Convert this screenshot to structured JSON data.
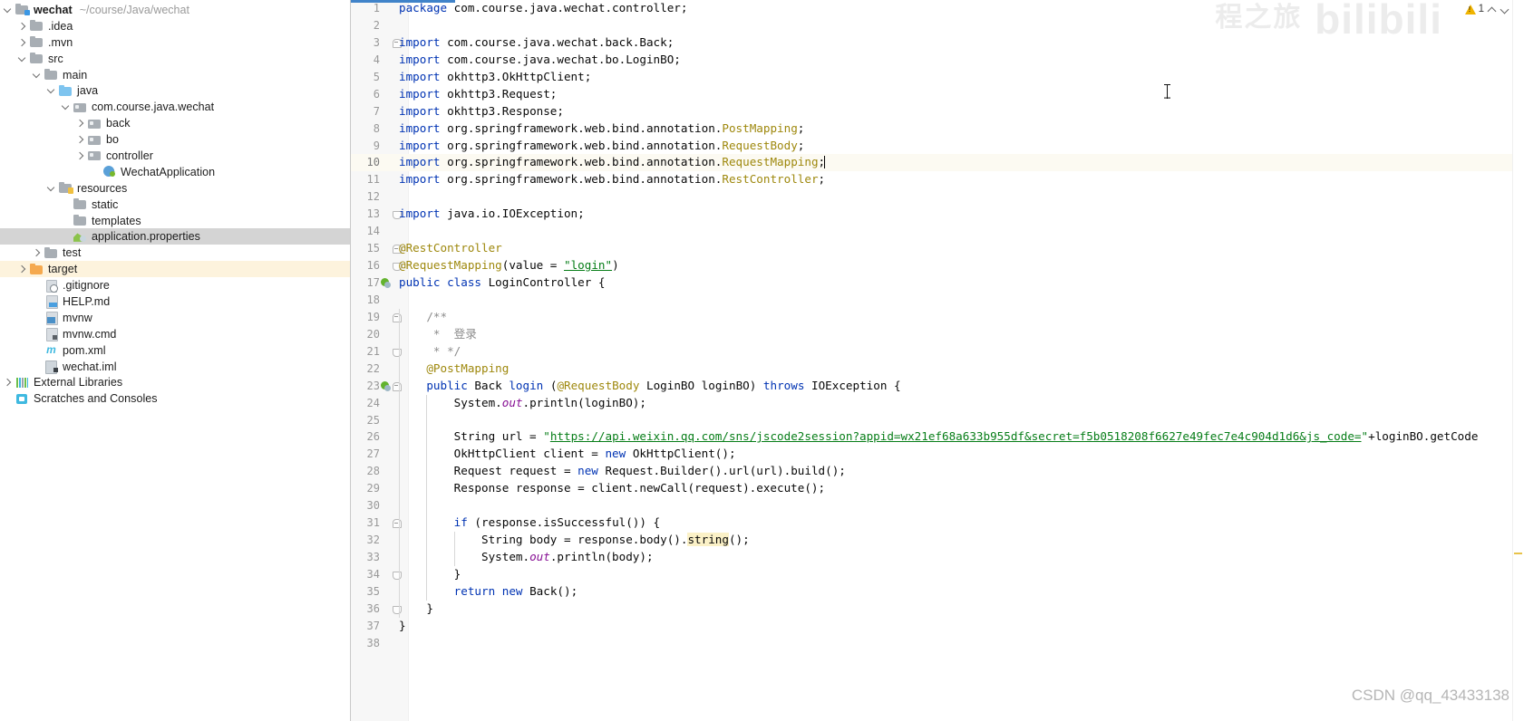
{
  "project": {
    "root": {
      "name": "wechat",
      "path": "~/course/Java/wechat"
    },
    "items": [
      {
        "label": ".idea",
        "indent": 1,
        "twisty": "closed",
        "icon": "folder",
        "state": ""
      },
      {
        "label": ".mvn",
        "indent": 1,
        "twisty": "closed",
        "icon": "folder",
        "state": ""
      },
      {
        "label": "src",
        "indent": 1,
        "twisty": "open",
        "icon": "folder",
        "state": ""
      },
      {
        "label": "main",
        "indent": 2,
        "twisty": "open",
        "icon": "folder",
        "state": ""
      },
      {
        "label": "java",
        "indent": 3,
        "twisty": "open",
        "icon": "folder-src",
        "state": ""
      },
      {
        "label": "com.course.java.wechat",
        "indent": 4,
        "twisty": "open",
        "icon": "folder-pkg",
        "state": ""
      },
      {
        "label": "back",
        "indent": 5,
        "twisty": "closed",
        "icon": "folder-pkg",
        "state": ""
      },
      {
        "label": "bo",
        "indent": 5,
        "twisty": "closed",
        "icon": "folder-pkg",
        "state": ""
      },
      {
        "label": "controller",
        "indent": 5,
        "twisty": "closed",
        "icon": "folder-pkg",
        "state": ""
      },
      {
        "label": "WechatApplication",
        "indent": 6,
        "twisty": "none",
        "icon": "spring-app",
        "state": ""
      },
      {
        "label": "resources",
        "indent": 3,
        "twisty": "open",
        "icon": "folder-res",
        "state": ""
      },
      {
        "label": "static",
        "indent": 4,
        "twisty": "none",
        "icon": "folder",
        "state": ""
      },
      {
        "label": "templates",
        "indent": 4,
        "twisty": "none",
        "icon": "folder",
        "state": ""
      },
      {
        "label": "application.properties",
        "indent": 4,
        "twisty": "none",
        "icon": "props",
        "state": "selected"
      },
      {
        "label": "test",
        "indent": 2,
        "twisty": "closed",
        "icon": "folder",
        "state": ""
      },
      {
        "label": "target",
        "indent": 1,
        "twisty": "closed",
        "icon": "folder-target",
        "state": "highlight"
      },
      {
        "label": ".gitignore",
        "indent": 2,
        "twisty": "none",
        "icon": "git",
        "state": ""
      },
      {
        "label": "HELP.md",
        "indent": 2,
        "twisty": "none",
        "icon": "file-md",
        "state": ""
      },
      {
        "label": "mvnw",
        "indent": 2,
        "twisty": "none",
        "icon": "file-mvnw",
        "state": ""
      },
      {
        "label": "mvnw.cmd",
        "indent": 2,
        "twisty": "none",
        "icon": "file",
        "state": ""
      },
      {
        "label": "pom.xml",
        "indent": 2,
        "twisty": "none",
        "icon": "maven",
        "state": ""
      },
      {
        "label": "wechat.iml",
        "indent": 2,
        "twisty": "none",
        "icon": "iml",
        "state": ""
      },
      {
        "label": "External Libraries",
        "indent": 0,
        "twisty": "closed",
        "icon": "libs",
        "state": ""
      },
      {
        "label": "Scratches and Consoles",
        "indent": 0,
        "twisty": "none",
        "icon": "scratch",
        "state": ""
      }
    ]
  },
  "editor": {
    "caret_line": 10,
    "lines": [
      {
        "n": 1,
        "fold": "",
        "run": false,
        "tokens": [
          {
            "t": "package ",
            "c": "kw"
          },
          {
            "t": "com.course.java.wechat.controller;",
            "c": "plain"
          }
        ]
      },
      {
        "n": 2,
        "fold": "",
        "run": false,
        "tokens": []
      },
      {
        "n": 3,
        "fold": "start",
        "run": false,
        "tokens": [
          {
            "t": "import ",
            "c": "kw"
          },
          {
            "t": "com.course.java.wechat.back.Back;",
            "c": "plain"
          }
        ]
      },
      {
        "n": 4,
        "fold": "",
        "run": false,
        "tokens": [
          {
            "t": "import ",
            "c": "kw"
          },
          {
            "t": "com.course.java.wechat.bo.LoginBO;",
            "c": "plain"
          }
        ]
      },
      {
        "n": 5,
        "fold": "",
        "run": false,
        "tokens": [
          {
            "t": "import ",
            "c": "kw"
          },
          {
            "t": "okhttp3.OkHttpClient;",
            "c": "plain"
          }
        ]
      },
      {
        "n": 6,
        "fold": "",
        "run": false,
        "tokens": [
          {
            "t": "import ",
            "c": "kw"
          },
          {
            "t": "okhttp3.Request;",
            "c": "plain"
          }
        ]
      },
      {
        "n": 7,
        "fold": "",
        "run": false,
        "tokens": [
          {
            "t": "import ",
            "c": "kw"
          },
          {
            "t": "okhttp3.Response;",
            "c": "plain"
          }
        ]
      },
      {
        "n": 8,
        "fold": "",
        "run": false,
        "tokens": [
          {
            "t": "import ",
            "c": "kw"
          },
          {
            "t": "org.springframework.web.bind.annotation.",
            "c": "plain"
          },
          {
            "t": "PostMapping",
            "c": "anno"
          },
          {
            "t": ";",
            "c": "plain"
          }
        ]
      },
      {
        "n": 9,
        "fold": "",
        "run": false,
        "tokens": [
          {
            "t": "import ",
            "c": "kw"
          },
          {
            "t": "org.springframework.web.bind.annotation.",
            "c": "plain"
          },
          {
            "t": "RequestBody",
            "c": "anno"
          },
          {
            "t": ";",
            "c": "plain"
          }
        ]
      },
      {
        "n": 10,
        "fold": "",
        "run": false,
        "caret": true,
        "tokens": [
          {
            "t": "import ",
            "c": "kw"
          },
          {
            "t": "org.springframework.web.bind.annotation.",
            "c": "plain"
          },
          {
            "t": "RequestMapping",
            "c": "anno"
          },
          {
            "t": ";",
            "c": "plain"
          }
        ]
      },
      {
        "n": 11,
        "fold": "",
        "run": false,
        "tokens": [
          {
            "t": "import ",
            "c": "kw"
          },
          {
            "t": "org.springframework.web.bind.annotation.",
            "c": "plain"
          },
          {
            "t": "RestController",
            "c": "anno"
          },
          {
            "t": ";",
            "c": "plain"
          }
        ]
      },
      {
        "n": 12,
        "fold": "",
        "run": false,
        "tokens": []
      },
      {
        "n": 13,
        "fold": "end",
        "run": false,
        "tokens": [
          {
            "t": "import ",
            "c": "kw"
          },
          {
            "t": "java.io.IOException;",
            "c": "plain"
          }
        ]
      },
      {
        "n": 14,
        "fold": "",
        "run": false,
        "tokens": []
      },
      {
        "n": 15,
        "fold": "start",
        "run": false,
        "tokens": [
          {
            "t": "@RestController",
            "c": "anno"
          }
        ]
      },
      {
        "n": 16,
        "fold": "end",
        "run": false,
        "tokens": [
          {
            "t": "@RequestMapping",
            "c": "anno"
          },
          {
            "t": "(value = ",
            "c": "plain"
          },
          {
            "t": "\"login\"",
            "c": "strlink"
          },
          {
            "t": ")",
            "c": "plain"
          }
        ]
      },
      {
        "n": 17,
        "fold": "",
        "run": true,
        "tokens": [
          {
            "t": "public class ",
            "c": "kw"
          },
          {
            "t": "LoginController {",
            "c": "plain"
          }
        ]
      },
      {
        "n": 18,
        "fold": "",
        "run": false,
        "tokens": []
      },
      {
        "n": 19,
        "fold": "start",
        "run": false,
        "indent": 1,
        "tokens": [
          {
            "t": "    /**",
            "c": "cmt"
          }
        ]
      },
      {
        "n": 20,
        "fold": "",
        "run": false,
        "indent": 1,
        "tokens": [
          {
            "t": "     *  登录",
            "c": "cmt"
          }
        ]
      },
      {
        "n": 21,
        "fold": "end",
        "run": false,
        "indent": 1,
        "tokens": [
          {
            "t": "     * */",
            "c": "cmt"
          }
        ]
      },
      {
        "n": 22,
        "fold": "",
        "run": false,
        "indent": 1,
        "tokens": [
          {
            "t": "    ",
            "c": "plain"
          },
          {
            "t": "@PostMapping",
            "c": "anno"
          }
        ]
      },
      {
        "n": 23,
        "fold": "start",
        "run": true,
        "indent": 1,
        "tokens": [
          {
            "t": "    ",
            "c": "plain"
          },
          {
            "t": "public ",
            "c": "kw"
          },
          {
            "t": "Back ",
            "c": "plain"
          },
          {
            "t": "login",
            "c": "kw"
          },
          {
            "t": " (",
            "c": "plain"
          },
          {
            "t": "@RequestBody",
            "c": "anno"
          },
          {
            "t": " LoginBO loginBO) ",
            "c": "plain"
          },
          {
            "t": "throws ",
            "c": "kw"
          },
          {
            "t": "IOException {",
            "c": "plain"
          }
        ]
      },
      {
        "n": 24,
        "fold": "",
        "run": false,
        "indent": 2,
        "tokens": [
          {
            "t": "        System.",
            "c": "plain"
          },
          {
            "t": "out",
            "c": "stat"
          },
          {
            "t": ".println(loginBO);",
            "c": "plain"
          }
        ]
      },
      {
        "n": 25,
        "fold": "",
        "run": false,
        "indent": 2,
        "tokens": []
      },
      {
        "n": 26,
        "fold": "",
        "run": false,
        "indent": 2,
        "tokens": [
          {
            "t": "        String url = ",
            "c": "plain"
          },
          {
            "t": "\"",
            "c": "str"
          },
          {
            "t": "https://api.weixin.qq.com/sns/jscode2session?appid=wx21ef68a633b955df&secret=f5b0518208f6627e49fec7e4c904d1d6&js_code=",
            "c": "strlink"
          },
          {
            "t": "\"",
            "c": "str"
          },
          {
            "t": "+loginBO.getCode",
            "c": "plain"
          }
        ]
      },
      {
        "n": 27,
        "fold": "",
        "run": false,
        "indent": 2,
        "tokens": [
          {
            "t": "        OkHttpClient client = ",
            "c": "plain"
          },
          {
            "t": "new ",
            "c": "kw"
          },
          {
            "t": "OkHttpClient();",
            "c": "plain"
          }
        ]
      },
      {
        "n": 28,
        "fold": "",
        "run": false,
        "indent": 2,
        "tokens": [
          {
            "t": "        Request request = ",
            "c": "plain"
          },
          {
            "t": "new ",
            "c": "kw"
          },
          {
            "t": "Request.Builder().url(url).build();",
            "c": "plain"
          }
        ]
      },
      {
        "n": 29,
        "fold": "",
        "run": false,
        "indent": 2,
        "tokens": [
          {
            "t": "        Response response = client.newCall(request).execute();",
            "c": "plain"
          }
        ]
      },
      {
        "n": 30,
        "fold": "",
        "run": false,
        "indent": 2,
        "tokens": []
      },
      {
        "n": 31,
        "fold": "start",
        "run": false,
        "indent": 2,
        "tokens": [
          {
            "t": "        ",
            "c": "plain"
          },
          {
            "t": "if ",
            "c": "kw"
          },
          {
            "t": "(response.isSuccessful()) {",
            "c": "plain"
          }
        ]
      },
      {
        "n": 32,
        "fold": "",
        "run": false,
        "indent": 3,
        "tokens": [
          {
            "t": "            String body = response.body().",
            "c": "plain"
          },
          {
            "t": "string",
            "c": "hl"
          },
          {
            "t": "();",
            "c": "plain"
          }
        ]
      },
      {
        "n": 33,
        "fold": "",
        "run": false,
        "indent": 3,
        "tokens": [
          {
            "t": "            System.",
            "c": "plain"
          },
          {
            "t": "out",
            "c": "stat"
          },
          {
            "t": ".println(body);",
            "c": "plain"
          }
        ]
      },
      {
        "n": 34,
        "fold": "end",
        "run": false,
        "indent": 2,
        "tokens": [
          {
            "t": "        }",
            "c": "plain"
          }
        ]
      },
      {
        "n": 35,
        "fold": "",
        "run": false,
        "indent": 2,
        "tokens": [
          {
            "t": "        ",
            "c": "plain"
          },
          {
            "t": "return new ",
            "c": "kw"
          },
          {
            "t": "Back();",
            "c": "plain"
          }
        ]
      },
      {
        "n": 36,
        "fold": "end",
        "run": false,
        "indent": 1,
        "tokens": [
          {
            "t": "    }",
            "c": "plain"
          }
        ]
      },
      {
        "n": 37,
        "fold": "",
        "run": false,
        "tokens": [
          {
            "t": "}",
            "c": "plain"
          }
        ]
      },
      {
        "n": 38,
        "fold": "",
        "run": false,
        "tokens": []
      }
    ]
  },
  "status": {
    "warning_count": "1"
  },
  "watermarks": {
    "bilibili_cn": "程之旅",
    "bilibili": "bilibili",
    "csdn": "CSDN @qq_43433138"
  },
  "colors": {
    "keyword": "#0033b3",
    "annotation": "#9e880d",
    "string": "#067d17",
    "comment": "#8c8c8c",
    "static_field": "#871094",
    "caret_line_bg": "#fcfaf2",
    "selection_bg": "#d4d4d4",
    "highlight_row_bg": "#fdf3dd",
    "warning": "#f0b400",
    "tab_underline": "#4083c9"
  }
}
